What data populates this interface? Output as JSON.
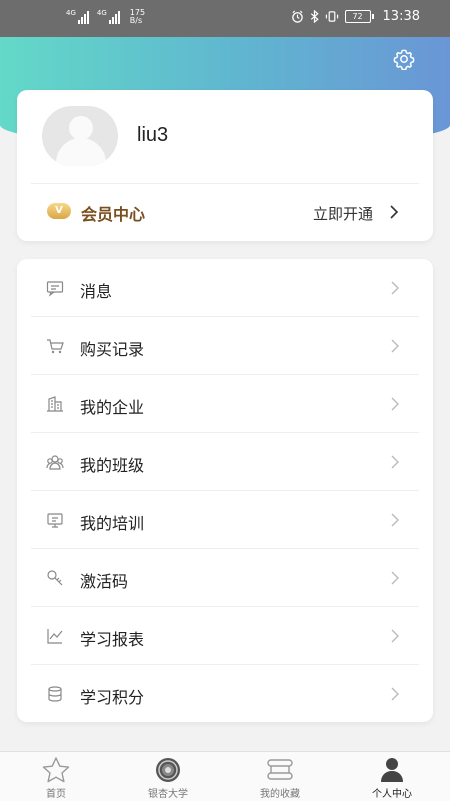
{
  "status_bar": {
    "signal_1": "4G",
    "signal_2": "4G",
    "net_speed_value": "175",
    "net_speed_unit": "B/s",
    "battery": "72",
    "time": "13:38"
  },
  "profile": {
    "username": "liu3"
  },
  "vip": {
    "badge": "V",
    "label": "会员中心",
    "action": "立即开通"
  },
  "menu": {
    "items": [
      {
        "label": "消息",
        "icon": "message-icon"
      },
      {
        "label": "购买记录",
        "icon": "cart-icon"
      },
      {
        "label": "我的企业",
        "icon": "building-icon"
      },
      {
        "label": "我的班级",
        "icon": "class-icon"
      },
      {
        "label": "我的培训",
        "icon": "training-icon"
      },
      {
        "label": "激活码",
        "icon": "key-icon"
      },
      {
        "label": "学习报表",
        "icon": "chart-icon"
      },
      {
        "label": "学习积分",
        "icon": "coins-icon"
      }
    ]
  },
  "bottom_nav": {
    "items": [
      {
        "label": "首页",
        "icon": "star-icon"
      },
      {
        "label": "银杏大学",
        "icon": "university-logo-icon"
      },
      {
        "label": "我的收藏",
        "icon": "favorites-icon"
      },
      {
        "label": "个人中心",
        "icon": "person-icon",
        "active": true
      }
    ]
  },
  "colors": {
    "header_gradient_start": "#63d9c8",
    "header_gradient_end": "#6a96d6",
    "vip_gold": "#d9a746",
    "vip_text": "#7a4e1e"
  }
}
